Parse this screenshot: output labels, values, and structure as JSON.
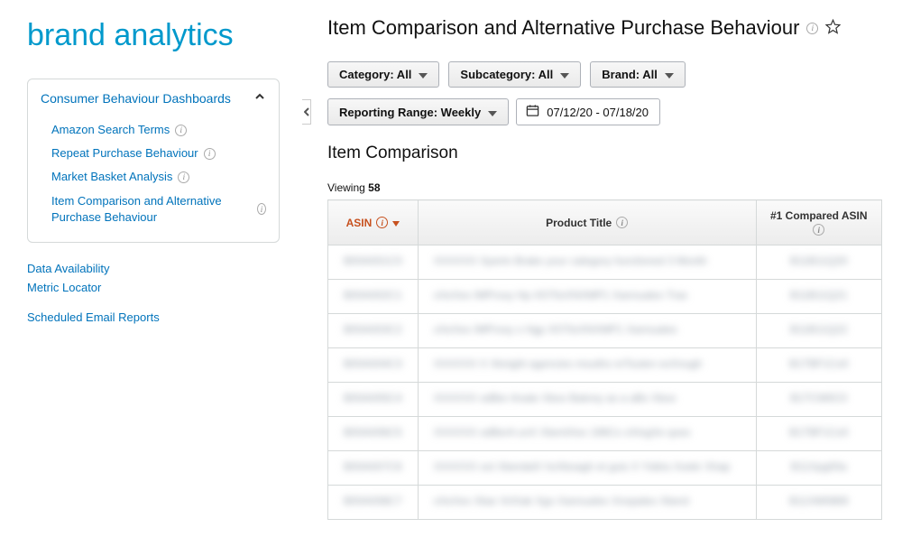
{
  "brand": "brand analytics",
  "nav": {
    "panel_title": "Consumer Behaviour Dashboards",
    "items": [
      "Amazon Search Terms",
      "Repeat Purchase Behaviour",
      "Market Basket Analysis",
      "Item Comparison and Alternative Purchase Behaviour"
    ],
    "links": {
      "availability": "Data Availability",
      "metric": "Metric Locator",
      "scheduled": "Scheduled Email Reports"
    }
  },
  "page": {
    "title": "Item Comparison and Alternative Purchase Behaviour"
  },
  "filters": {
    "category": "Category: All",
    "subcategory": "Subcategory: All",
    "brand": "Brand: All",
    "range_label": "Reporting Range: Weekly",
    "date_range": "07/12/20 - 07/18/20"
  },
  "section": {
    "title": "Item Comparison",
    "viewing_prefix": "Viewing ",
    "viewing_count": "58"
  },
  "table": {
    "headers": {
      "asin": "ASIN",
      "product_title": "Product Title",
      "compared": "#1 Compared ASIN"
    },
    "rows": [
      {
        "a": "B00A001C0",
        "t": "XXXXXX Xpertn Brake your category functioned 3 Month",
        "c": "B11B11Q20"
      },
      {
        "a": "B00A002C1",
        "t": "xXeXex IMProxy Hp-X070xXNXMP1 Xannualex Trax",
        "c": "B11B11Q21"
      },
      {
        "a": "B00A003C2",
        "t": "xXeXex IMProxy x Hgp X070xXNXMP1 Xannualex",
        "c": "B11B11Q22"
      },
      {
        "a": "B00A004C3",
        "t": "XXXXXX X Xknight agencies mouths reTouten exXnugh",
        "c": "B1TBF1Cx0"
      },
      {
        "a": "B00A005C4",
        "t": "XXXXXX xdBer Anate Xbox Bakrey as a aBx Xbox",
        "c": "B1TCM0C0"
      },
      {
        "a": "B00A006C5",
        "t": "XXXXXX xdBerA unX XbentXex 196Cx xXingXe qxex",
        "c": "B1TBF1Cx0"
      },
      {
        "a": "B00A007C6",
        "t": "XXXXXX xot XberdalX hsXboagh et guis X Yddra Xoekr Xhap",
        "c": "B11Xpg00a"
      },
      {
        "a": "B00A008C7",
        "t": "xXeXex Xbar XrtXak Xgo Xannualex Xnopalex Xberd",
        "c": "B11XM0869"
      }
    ]
  }
}
